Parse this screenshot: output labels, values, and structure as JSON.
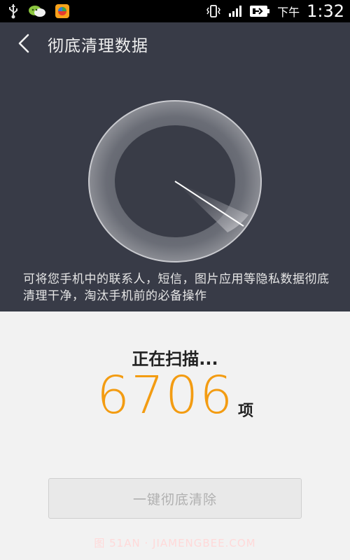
{
  "status_bar": {
    "time_prefix": "下午",
    "time": "1:32",
    "icons": [
      "usb-icon",
      "wechat-notification-icon",
      "app-notification-icon",
      "vibrate-icon",
      "signal-icon",
      "battery-charging-icon"
    ]
  },
  "header": {
    "title": "彻底清理数据",
    "back_icon": "chevron-left-icon"
  },
  "hero": {
    "description": "可将您手机中的联系人，短信，图片应用等隐私数据彻底清理干净，淘汰手机前的必备操作"
  },
  "scan": {
    "status": "正在扫描...",
    "count": "6706",
    "unit": "项",
    "progress_fraction": 0.13
  },
  "actions": {
    "clean_button": "一键彻底清除"
  },
  "watermark": "图 51AN · JIAMENGBEE.COM",
  "colors": {
    "dark_bg": "#383b47",
    "accent": "#f39c12",
    "light_bg": "#f2f2f2"
  }
}
